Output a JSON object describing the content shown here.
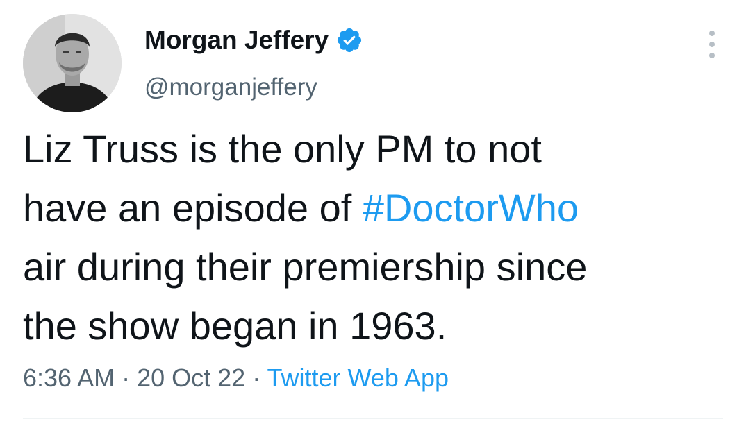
{
  "author": {
    "display_name": "Morgan Jeffery",
    "handle": "@morganjeffery",
    "verified": true,
    "avatar_icon": "profile-photo"
  },
  "more_menu_icon": "more-vertical-icon",
  "tweet": {
    "lines": [
      {
        "text": "Liz Truss is the only PM to not"
      },
      {
        "before": "have an episode of ",
        "hashtag": "#DoctorWho"
      },
      {
        "text": "air during their premiership since"
      },
      {
        "text": "the show began in 1963."
      }
    ]
  },
  "meta": {
    "time": "6:36 AM",
    "separator1": " · ",
    "date": "20 Oct 22",
    "separator2": " · ",
    "source": "Twitter Web App"
  },
  "colors": {
    "text": "#0f1419",
    "secondary": "#536471",
    "accent": "#1d9bf0"
  }
}
